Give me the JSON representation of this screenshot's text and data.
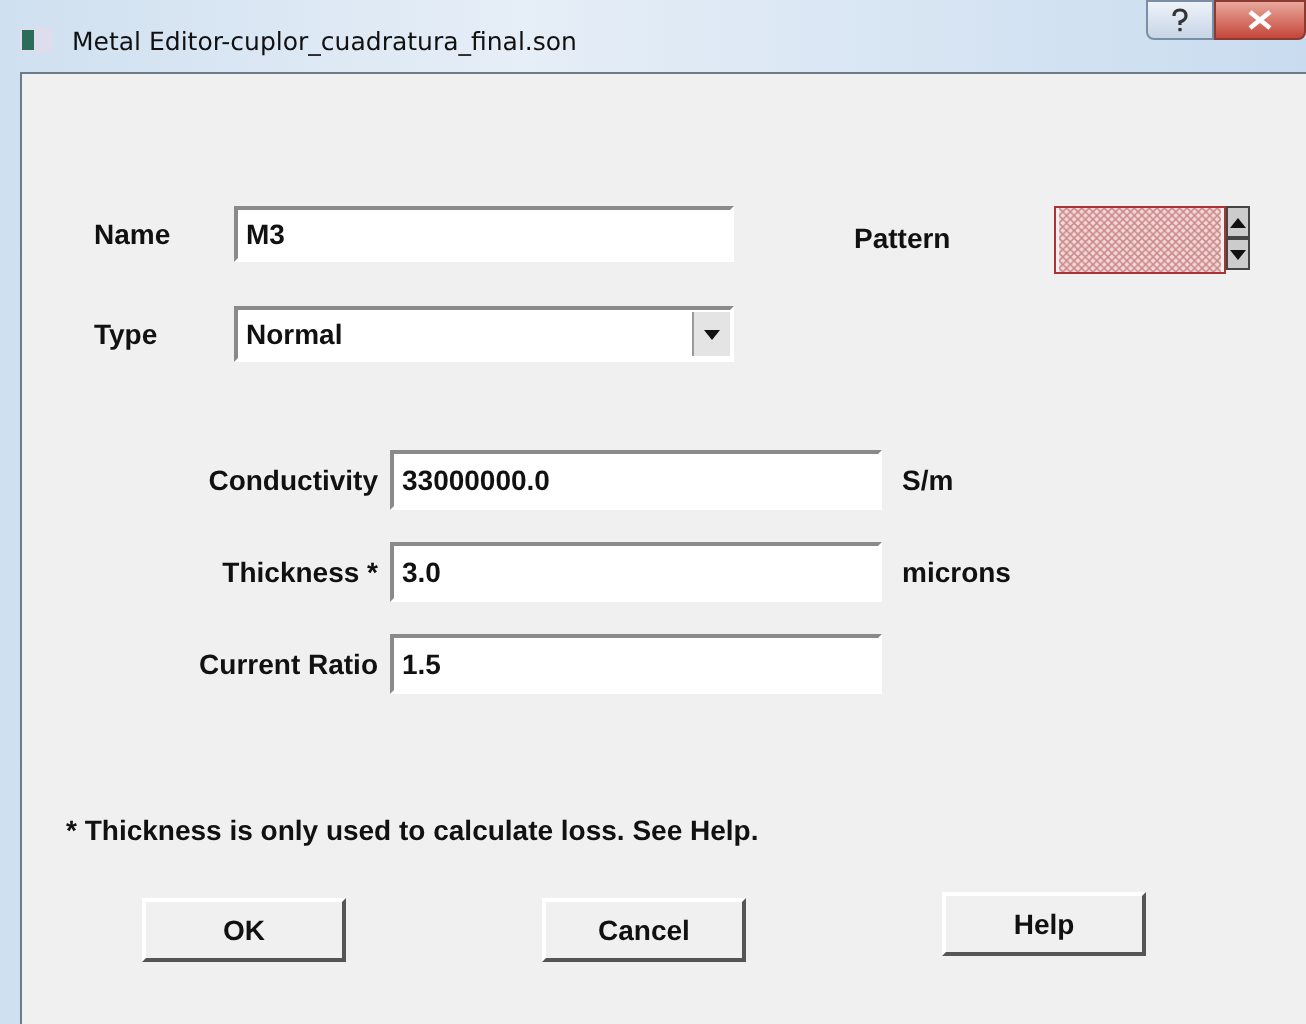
{
  "window": {
    "title": "Metal Editor-cuplor_cuadratura_final.son"
  },
  "name": {
    "label": "Name",
    "value": "M3"
  },
  "pattern": {
    "label": "Pattern"
  },
  "type": {
    "label": "Type",
    "value": "Normal"
  },
  "properties": [
    {
      "label": "Conductivity",
      "value": "33000000.0",
      "unit": "S/m"
    },
    {
      "label": "Thickness *",
      "value": "3.0",
      "unit": "microns"
    },
    {
      "label": "Current Ratio",
      "value": "1.5"
    }
  ],
  "footnote": "* Thickness is only used to calculate loss. See Help.",
  "buttons": [
    "OK",
    "Cancel",
    "Help"
  ]
}
